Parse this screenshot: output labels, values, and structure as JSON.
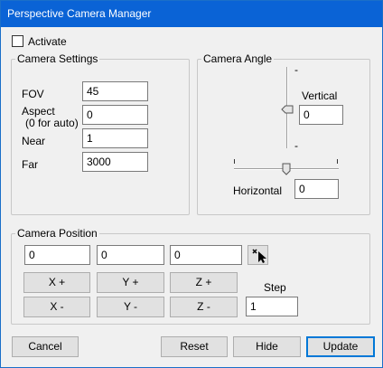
{
  "window": {
    "title": "Perspective Camera Manager"
  },
  "activate": {
    "label": "Activate",
    "checked": false
  },
  "camera_settings": {
    "title": "Camera Settings",
    "fov": {
      "label": "FOV",
      "value": "45"
    },
    "aspect": {
      "label_line1": "Aspect",
      "label_line2": "(0 for auto)",
      "value": "0"
    },
    "near": {
      "label": "Near",
      "value": "1"
    },
    "far": {
      "label": "Far",
      "value": "3000"
    }
  },
  "camera_angle": {
    "title": "Camera Angle",
    "vertical": {
      "label": "Vertical",
      "value": "0",
      "tick_top": "-",
      "tick_bottom": "-"
    },
    "horizontal": {
      "label": "Horizontal",
      "value": "0"
    }
  },
  "camera_position": {
    "title": "Camera Position",
    "x": "0",
    "y": "0",
    "z": "0",
    "buttons": {
      "x_plus": "X +",
      "y_plus": "Y +",
      "z_plus": "Z +",
      "x_minus": "X -",
      "y_minus": "Y -",
      "z_minus": "Z -"
    },
    "step": {
      "label": "Step",
      "value": "1"
    }
  },
  "footer": {
    "cancel": "Cancel",
    "reset": "Reset",
    "hide": "Hide",
    "update": "Update"
  }
}
